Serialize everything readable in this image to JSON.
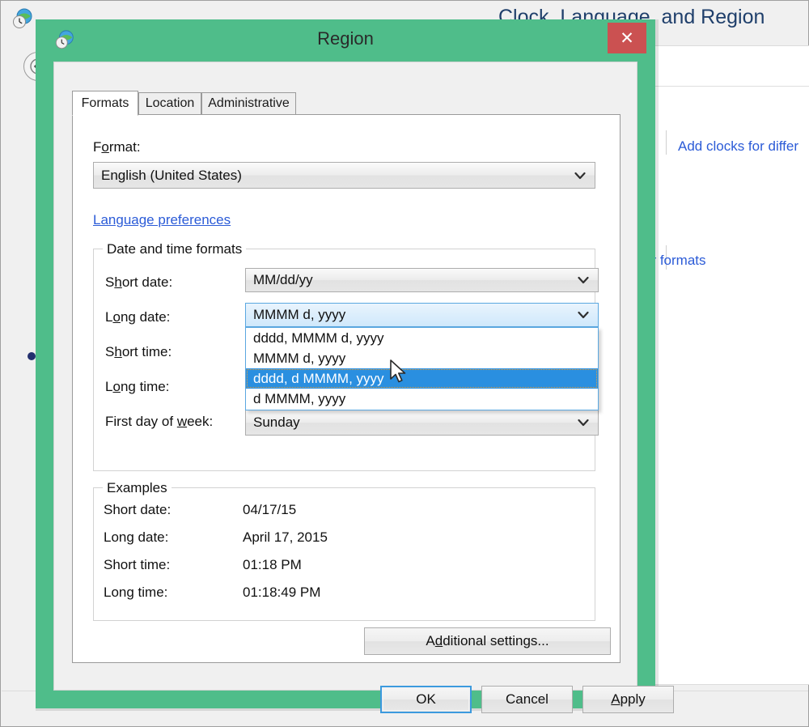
{
  "background": {
    "window_title": "Clock, Language, and Region",
    "back_icon": "back-arrow-icon",
    "globe_clock_icon": "globe-clock-icon",
    "links": [
      {
        "label": "Add clocks for differ",
        "name": "add-clocks-link"
      },
      {
        "label": "er formats",
        "name": "number-formats-link"
      }
    ]
  },
  "dialog": {
    "title": "Region",
    "title_icon": "globe-clock-icon",
    "close_label": "✕",
    "tabs": [
      {
        "label": "Formats",
        "active": true
      },
      {
        "label": "Location",
        "active": false
      },
      {
        "label": "Administrative",
        "active": false
      }
    ],
    "format": {
      "label_pre": "F",
      "label_accel": "o",
      "label_post": "rmat:",
      "value": "English (United States)"
    },
    "language_preferences_link": "Language preferences",
    "datetime_group": {
      "title": "Date and time formats",
      "rows": [
        {
          "label_pre": "S",
          "label_accel": "h",
          "label_post": "ort date:",
          "value": "MM/dd/yy",
          "name": "short-date"
        },
        {
          "label_pre": "L",
          "label_accel": "o",
          "label_post": "ng date:",
          "value": "MMMM d, yyyy",
          "name": "long-date"
        },
        {
          "label_pre": "S",
          "label_accel": "h",
          "label_post": "ort time:",
          "value": "",
          "name": "short-time"
        },
        {
          "label_pre": "L",
          "label_accel": "o",
          "label_post": "ng time:",
          "value": "",
          "name": "long-time"
        },
        {
          "label_pre": "First day of ",
          "label_accel": "w",
          "label_post": "eek:",
          "value": "Sunday",
          "name": "first-day-of-week"
        }
      ],
      "long_date_dropdown": {
        "open": true,
        "options": [
          {
            "label": "dddd, MMMM d, yyyy",
            "selected": false
          },
          {
            "label": "MMMM d, yyyy",
            "selected": false
          },
          {
            "label": "dddd, d MMMM, yyyy",
            "selected": true
          },
          {
            "label": "d MMMM, yyyy",
            "selected": false
          }
        ]
      }
    },
    "examples_group": {
      "title": "Examples",
      "rows": [
        {
          "label": "Short date:",
          "value": "04/17/15"
        },
        {
          "label": "Long date:",
          "value": "April 17, 2015"
        },
        {
          "label": "Short time:",
          "value": "01:18 PM"
        },
        {
          "label": "Long time:",
          "value": "01:18:49 PM"
        }
      ]
    },
    "additional_settings": {
      "pre": "A",
      "accel": "d",
      "post": "ditional settings..."
    },
    "buttons": [
      {
        "label": "OK",
        "pre": "OK",
        "accel": "",
        "post": "",
        "focused": true,
        "name": "ok-button"
      },
      {
        "label": "Cancel",
        "pre": "Cancel",
        "accel": "",
        "post": "",
        "focused": false,
        "name": "cancel-button"
      },
      {
        "label": "Apply",
        "pre": "",
        "accel": "A",
        "post": "pply",
        "focused": false,
        "name": "apply-button"
      }
    ]
  },
  "colors": {
    "title_bar_green": "#4fbd8a",
    "close_red": "#cb5151",
    "highlight_blue": "#2a8fe0",
    "link_blue": "#2b5bd7",
    "heading_blue": "#1f3f6b"
  }
}
